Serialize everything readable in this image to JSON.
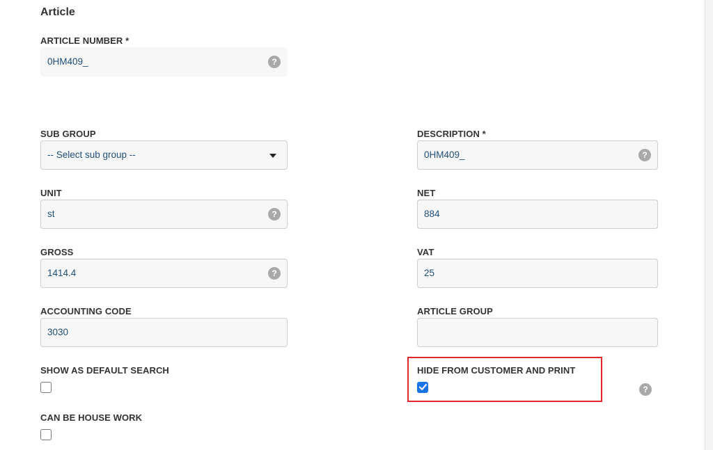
{
  "section": {
    "title": "Article"
  },
  "fields": {
    "article_number": {
      "label": "ARTICLE NUMBER *",
      "value": "0HM409_"
    },
    "sub_group": {
      "label": "SUB GROUP",
      "value": "-- Select sub group --"
    },
    "description": {
      "label": "DESCRIPTION *",
      "value": "0HM409_"
    },
    "unit": {
      "label": "UNIT",
      "value": "st"
    },
    "net": {
      "label": "NET",
      "value": "884"
    },
    "gross": {
      "label": "GROSS",
      "value": "1414.4"
    },
    "vat": {
      "label": "VAT",
      "value": "25"
    },
    "accounting_code": {
      "label": "ACCOUNTING CODE",
      "value": "3030"
    },
    "article_group": {
      "label": "ARTICLE GROUP",
      "value": ""
    }
  },
  "checkboxes": {
    "show_as_default_search": {
      "label": "SHOW AS DEFAULT SEARCH",
      "checked": false
    },
    "hide_from_customer": {
      "label": "HIDE FROM CUSTOMER AND PRINT",
      "checked": true
    },
    "can_be_house_work": {
      "label": "CAN BE HOUSE WORK",
      "checked": false
    }
  },
  "help_icon_text": "?",
  "colors": {
    "value_text": "#1f4e79",
    "checkbox_checked": "#1a73e8",
    "highlight_border": "#e3242b",
    "help_icon": "#a9a9a9"
  }
}
